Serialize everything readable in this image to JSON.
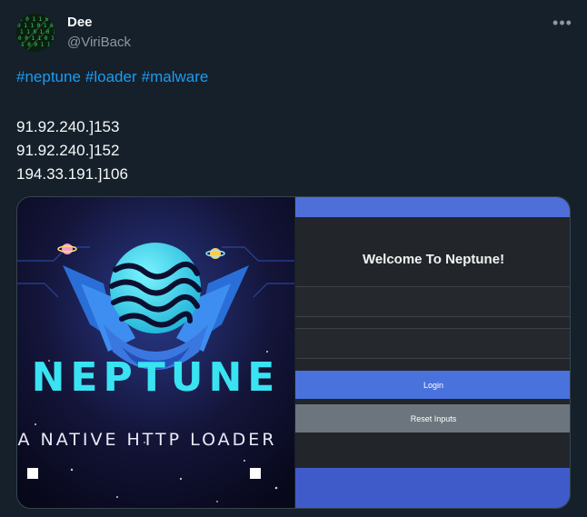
{
  "author": {
    "display_name": "Dee",
    "handle": "@ViriBack"
  },
  "tweet": {
    "hashtags": [
      "#neptune",
      "#loader",
      "#malware"
    ],
    "ips": [
      "91.92.240.]153",
      "91.92.240.]152",
      "194.33.191.]106"
    ]
  },
  "media": {
    "left_image": {
      "brand_text": "NEPTUNE",
      "tagline": "A NATIVE HTTP LOADER"
    },
    "right_image": {
      "welcome_title": "Welcome To Neptune!",
      "login_label": "Login",
      "reset_label": "Reset Inputs"
    }
  },
  "colors": {
    "background": "#15202b",
    "link": "#1d9bf0",
    "secondary_text": "#8b98a5",
    "neptune_accent": "#3ee6f0"
  },
  "icons": {
    "more": "more-horizontal-icon"
  }
}
